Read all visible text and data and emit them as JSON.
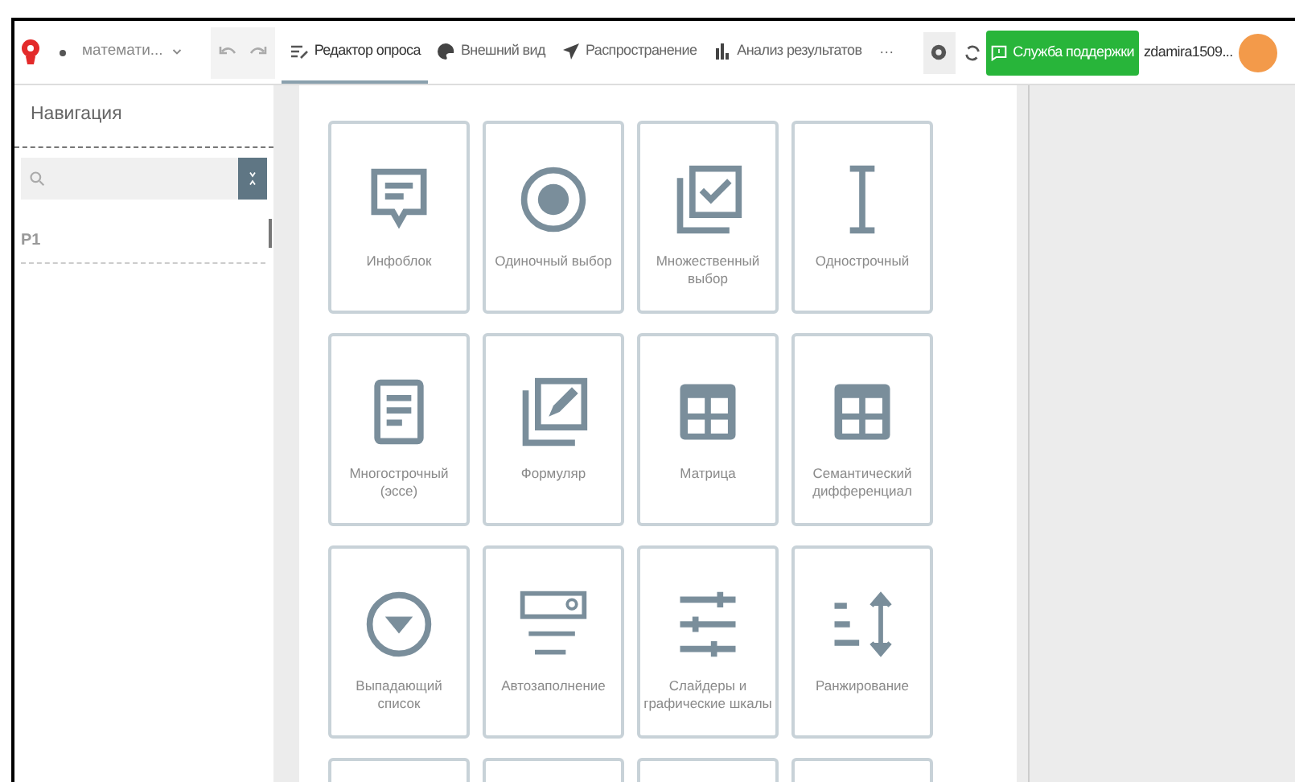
{
  "header": {
    "survey_name": "математи...",
    "tabs": [
      {
        "label": "Редактор опроса",
        "kind": "editor",
        "selected": true
      },
      {
        "label": "Внешний вид",
        "kind": "palette",
        "selected": false
      },
      {
        "label": "Распространение",
        "kind": "send",
        "selected": false
      },
      {
        "label": "Анализ результатов",
        "kind": "chart",
        "selected": false
      }
    ],
    "more": "···",
    "support_button": "Служба поддержки",
    "username": "zdamira1509..."
  },
  "sidebar": {
    "title": "Навигация",
    "pages": [
      "P1"
    ]
  },
  "question_types": [
    {
      "label": "Инфоблок",
      "kind": "info"
    },
    {
      "label": "Одиночный выбор",
      "kind": "radio"
    },
    {
      "label": "Множественный выбор",
      "kind": "checkbox"
    },
    {
      "label": "Однострочный",
      "kind": "cursor"
    },
    {
      "label": "Многострочный (эссе)",
      "kind": "document"
    },
    {
      "label": "Формуляр",
      "kind": "form"
    },
    {
      "label": "Матрица",
      "kind": "matrix"
    },
    {
      "label": "Семантический дифференциал",
      "kind": "matrix2"
    },
    {
      "label": "Выпадающий список",
      "kind": "dropdown"
    },
    {
      "label": "Автозаполнение",
      "kind": "autocomplete"
    },
    {
      "label": "Слайдеры и графические шкалы",
      "kind": "sliders"
    },
    {
      "label": "Ранжирование",
      "kind": "ranking"
    }
  ]
}
